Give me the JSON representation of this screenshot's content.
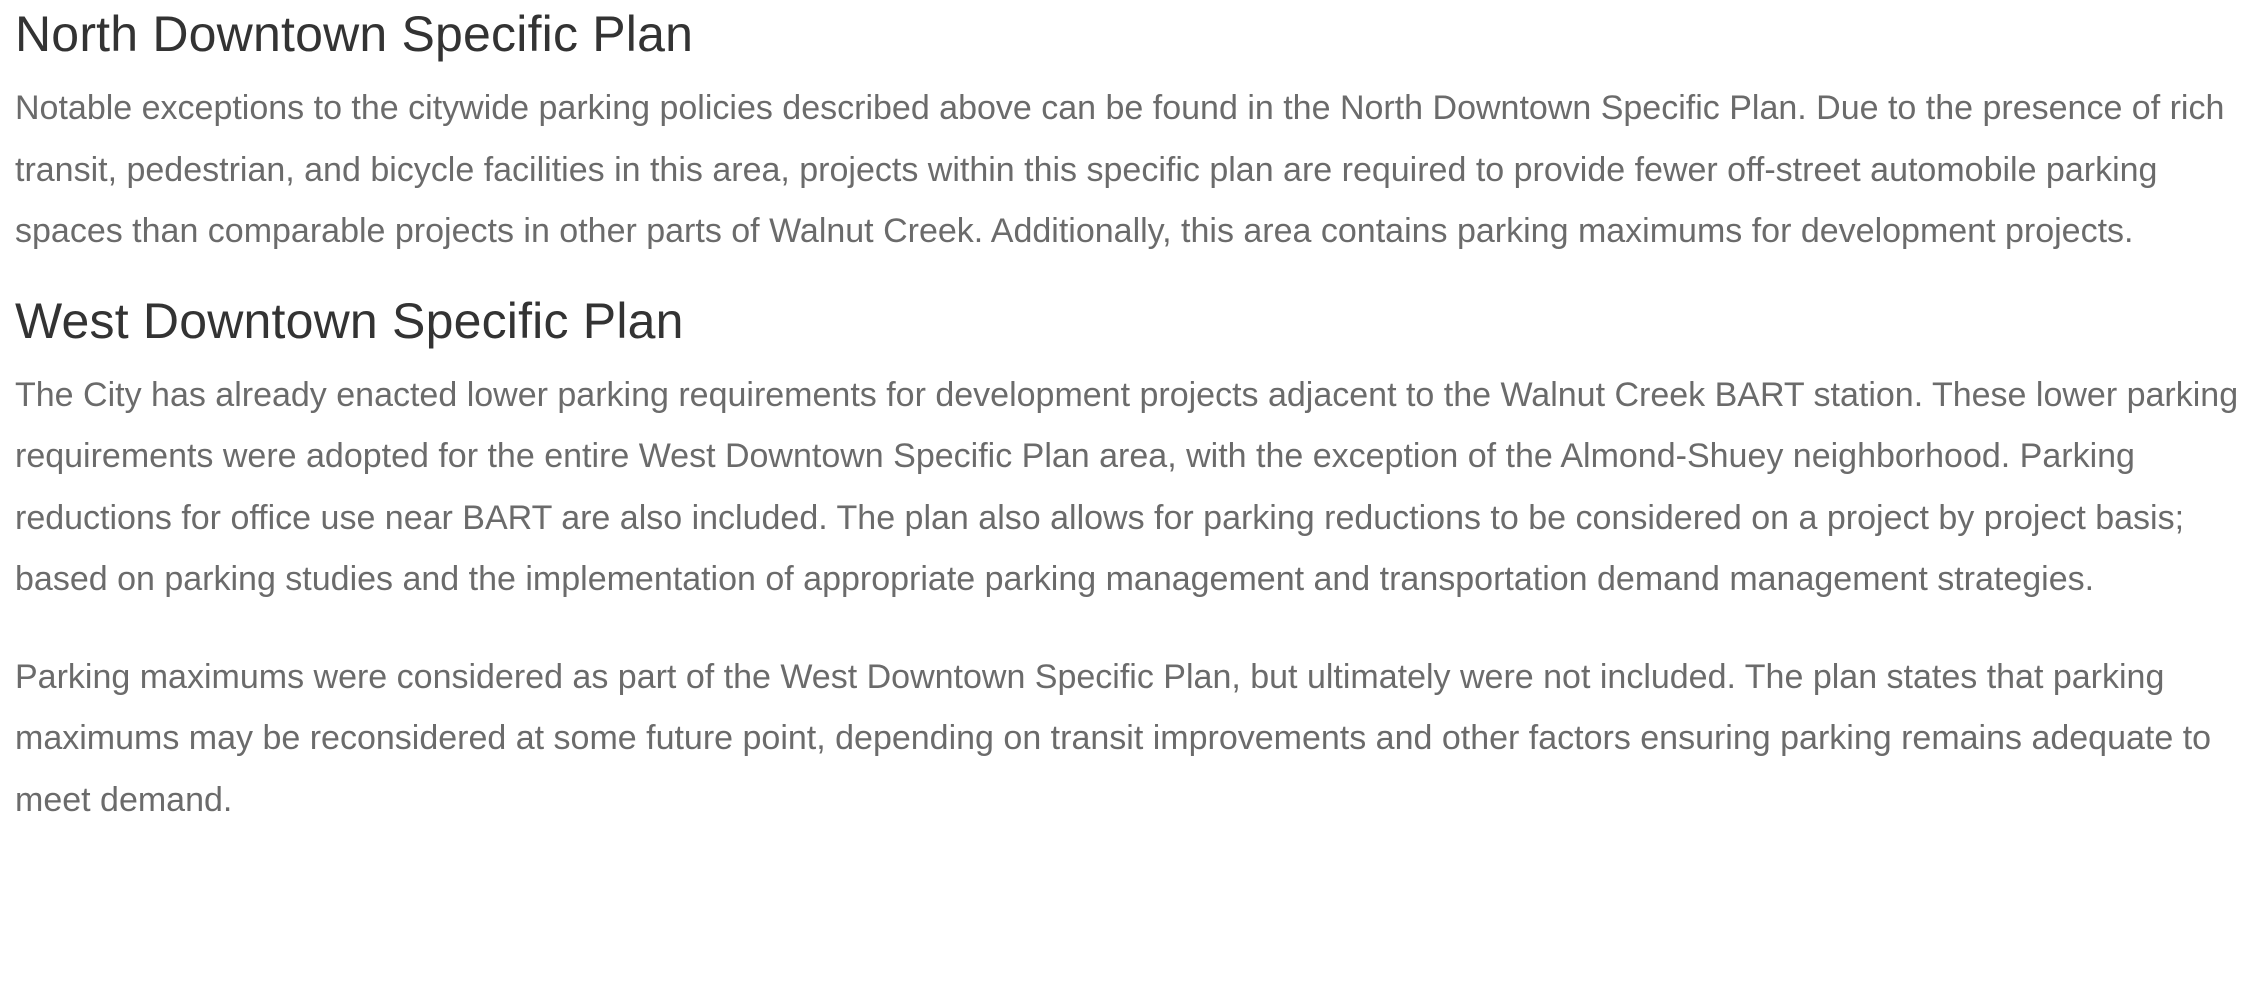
{
  "sections": [
    {
      "heading": "North Downtown Specific Plan",
      "paragraphs": [
        "Notable exceptions to the citywide parking policies described above can be found in the North Downtown Specific Plan. Due to the presence of rich transit, pedestrian, and bicycle facilities in this area, projects within this specific plan are required to provide fewer off-street automobile parking spaces than comparable projects in other parts of Walnut Creek. Additionally, this area contains parking maximums for development projects."
      ]
    },
    {
      "heading": "West Downtown Specific Plan",
      "paragraphs": [
        "The City has already enacted lower parking requirements for development projects adjacent to the Walnut Creek BART station. These lower parking requirements were adopted for the entire West Downtown Specific Plan area, with the exception of the Almond-Shuey neighborhood. Parking reductions for office use near BART are also included. The plan also allows for parking reductions to be considered on a project by project basis; based on parking studies and the implementation of appropriate parking management and transportation demand management strategies.",
        "Parking maximums were considered as part of the West Downtown Specific Plan, but ultimately were not included. The plan states that parking maximums may be reconsidered at some future point, depending on transit improvements and other factors ensuring parking remains adequate to meet demand."
      ]
    }
  ]
}
